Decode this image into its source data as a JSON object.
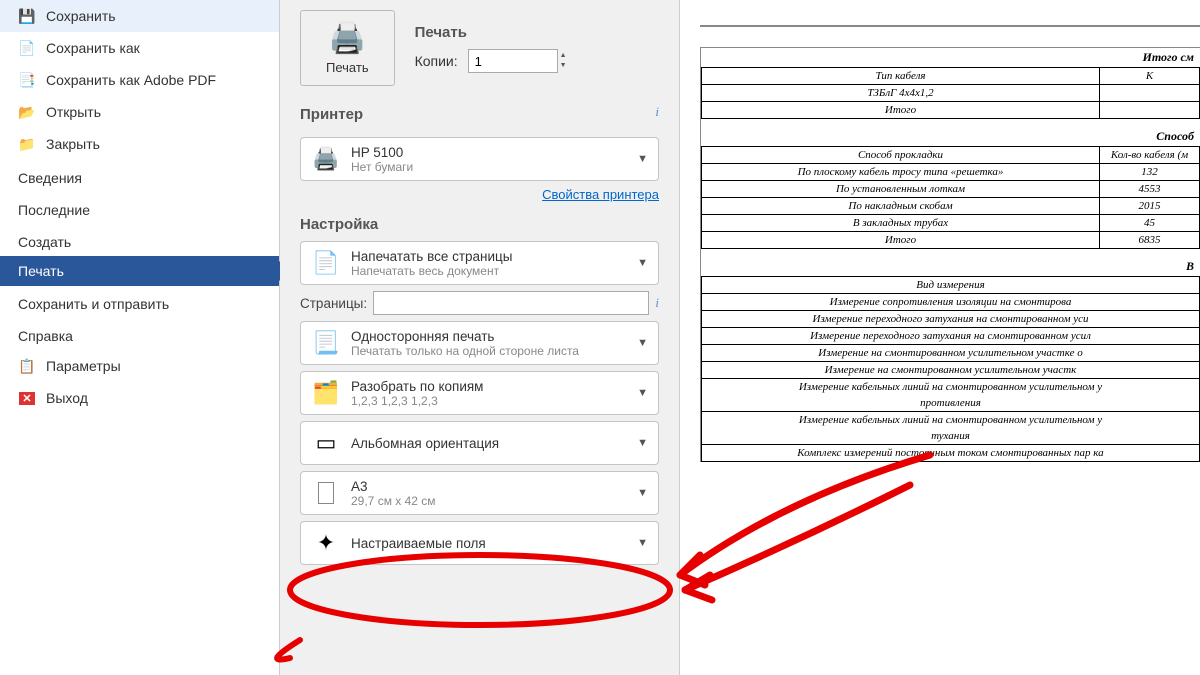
{
  "sidebar": {
    "save": "Сохранить",
    "save_as": "Сохранить как",
    "save_pdf": "Сохранить как Adobe PDF",
    "open": "Открыть",
    "close": "Закрыть",
    "info": "Сведения",
    "recent": "Последние",
    "create": "Создать",
    "print": "Печать",
    "save_send": "Сохранить и отправить",
    "help": "Справка",
    "options": "Параметры",
    "exit": "Выход"
  },
  "print": {
    "title": "Печать",
    "button": "Печать",
    "copies_label": "Копии:",
    "copies_value": "1"
  },
  "printer": {
    "title": "Принтер",
    "name": "HP 5100",
    "status": "Нет бумаги",
    "props": "Свойства принтера"
  },
  "settings": {
    "title": "Настройка",
    "range_main": "Напечатать все страницы",
    "range_sub": "Напечатать весь документ",
    "pages_label": "Страницы:",
    "duplex_main": "Односторонняя печать",
    "duplex_sub": "Печатать только на одной стороне листа",
    "collate_main": "Разобрать по копиям",
    "collate_sub": "1,2,3   1,2,3   1,2,3",
    "orient": "Альбомная ориентация",
    "paper_main": "A3",
    "paper_sub": "29,7 см x 42 см",
    "margins": "Настраиваемые поля"
  },
  "doc": {
    "t_itogo_sm": "Итого см",
    "h_cable_type": "Тип кабеля",
    "r_tzblg": "ТЗБлГ 4x4x1,2",
    "r_itogo": "Итого",
    "t_sposob": "Способ",
    "h_sposob": "Способ прокладки",
    "h_kolvo": "Кол-во кабеля (м",
    "r1a": "По плоскому кабель тросу типа «решетка»",
    "r1b": "132",
    "r2a": "По установленным лоткам",
    "r2b": "4553",
    "r3a": "По накладным скобам",
    "r3b": "2015",
    "r4a": "В закладных трубах",
    "r4b": "45",
    "r5a": "Итого",
    "r5b": "6835",
    "t_v": "В",
    "h_vid": "Вид измерения",
    "m1": "Измерение сопротивления изоляции на смонтирова",
    "m2": "Измерение переходного затухания на смонтированном уси",
    "m3": "Измерение переходного затухания на смонтированном усил",
    "m4": "Измерение на смонтированном усилительном участке о",
    "m5": "Измерение на смонтированном усилительном участк",
    "m6": "Измерение кабельных линий на смонтированном усилительном у",
    "m6b": "противления",
    "m7": "Измерение кабельных линий на смонтированном усилительном у",
    "m7b": "тухания",
    "m8": "Комплекс измерений постоянным током смонтированных пар ка"
  }
}
